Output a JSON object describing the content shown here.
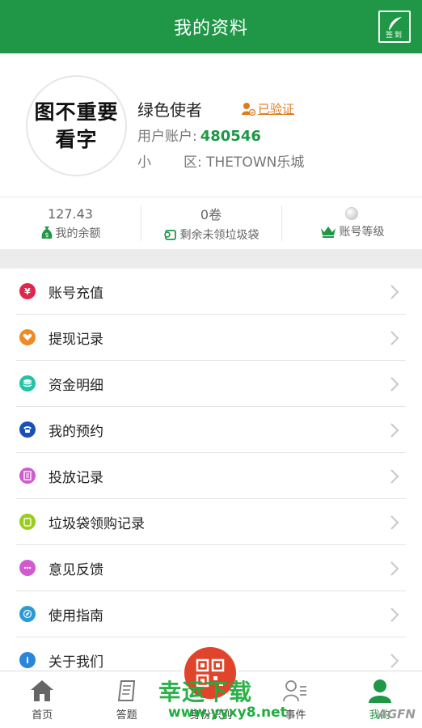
{
  "header": {
    "title": "我的资料",
    "signin_label": "签到"
  },
  "profile": {
    "avatar_text_line1": "图不重要",
    "avatar_text_line2": "看字",
    "nickname": "绿色使者",
    "verified_label": "已验证",
    "account_label": "用户账户:",
    "account_number": "480546",
    "community_label_1": "小",
    "community_label_2": "区:",
    "community_value": "THETOWN乐城"
  },
  "stats": [
    {
      "value": "127.43",
      "label": "我的余额",
      "icon": "money-bag-icon"
    },
    {
      "value": "0卷",
      "label": "剩余未领垃圾袋",
      "icon": "bag-roll-icon"
    },
    {
      "value": "",
      "label": "账号等级",
      "icon": "crown-icon"
    }
  ],
  "menu": [
    {
      "label": "账号充值",
      "icon": "yen-icon",
      "color": "#e0264a"
    },
    {
      "label": "提现记录",
      "icon": "heart-icon",
      "color": "#f08a24"
    },
    {
      "label": "资金明细",
      "icon": "database-icon",
      "color": "#22c3a6"
    },
    {
      "label": "我的预约",
      "icon": "phone-icon",
      "color": "#1b4fb8"
    },
    {
      "label": "投放记录",
      "icon": "document-icon",
      "color": "#d15ad0"
    },
    {
      "label": "垃圾袋领购记录",
      "icon": "bag-icon",
      "color": "#9acd1e"
    },
    {
      "label": "意见反馈",
      "icon": "chat-icon",
      "color": "#d15ad0"
    },
    {
      "label": "使用指南",
      "icon": "compass-icon",
      "color": "#2a9ad8"
    },
    {
      "label": "关于我们",
      "icon": "info-icon",
      "color": "#2a86d8"
    }
  ],
  "tabbar": [
    {
      "label": "首页",
      "icon": "home-icon",
      "active": false
    },
    {
      "label": "答题",
      "icon": "quiz-icon",
      "active": false
    },
    {
      "label": "身份识别",
      "icon": "qr-scan-icon",
      "active": false
    },
    {
      "label": "事件",
      "icon": "events-icon",
      "active": false
    },
    {
      "label": "我的",
      "icon": "person-icon",
      "active": true
    }
  ],
  "watermark": {
    "text": "幸运下载",
    "url": "www.yyxy8.net",
    "brand": "AGFN"
  },
  "colors": {
    "brand_green": "#1f9747",
    "accent_orange": "#e07a1f",
    "scan_red": "#e0442a"
  }
}
